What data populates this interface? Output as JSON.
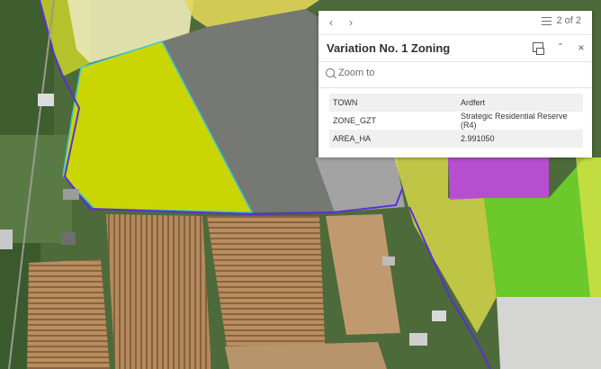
{
  "map": {
    "colors": {
      "zoning_yellow": "#e8e84a",
      "selected_fill": "#d7df00",
      "selected_outline": "#2fd0e6",
      "purple_zone": "#c24be0",
      "green_zone": "#6fd42a",
      "pale_zone": "#dcdcdc",
      "boundary": "#5a2fd6"
    }
  },
  "popup": {
    "pager_text": "2 of 2",
    "title": "Variation No. 1 Zoning",
    "zoom_label": "Zoom to",
    "icons": {
      "prev": "chevron-left-icon",
      "next": "chevron-right-icon",
      "pager": "list-icon",
      "dock": "dock-icon",
      "collapse": "chevron-up-icon",
      "close": "close-icon",
      "zoom": "magnifier-icon"
    },
    "attributes": [
      {
        "key": "TOWN",
        "value": "Ardfert"
      },
      {
        "key": "ZONE_GZT",
        "value": "Strategic Residential Reserve (R4)"
      },
      {
        "key": "AREA_HA",
        "value": "2.991050"
      }
    ]
  }
}
